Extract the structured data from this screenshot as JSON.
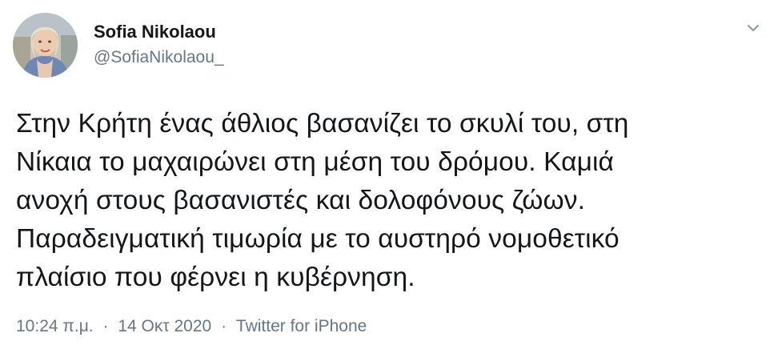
{
  "author": {
    "display_name": "Sofia Nikolaou",
    "handle": "@SofiaNikolaou_",
    "avatar_icon": "profile-photo"
  },
  "menu": {
    "icon": "chevron-down-icon"
  },
  "tweet": {
    "text": "Στην Κρήτη ένας άθλιος βασανίζει το σκυλί του, στη\nΝίκαια το μαχαιρώνει στη μέση του δρόμου. Καμιά\nανοχή στους βασανιστές και δολοφόνους ζώων.\nΠαραδειγματική τιμωρία με το αυστηρό νομοθετικό\nπλαίσιο που φέρνει η κυβέρνηση."
  },
  "meta": {
    "time": "10:24 π.μ.",
    "date": "14 Οκτ 2020",
    "source": "Twitter for iPhone",
    "separator": "·"
  },
  "colors": {
    "text_primary": "#14171a",
    "text_secondary": "#657786",
    "background": "#ffffff"
  }
}
